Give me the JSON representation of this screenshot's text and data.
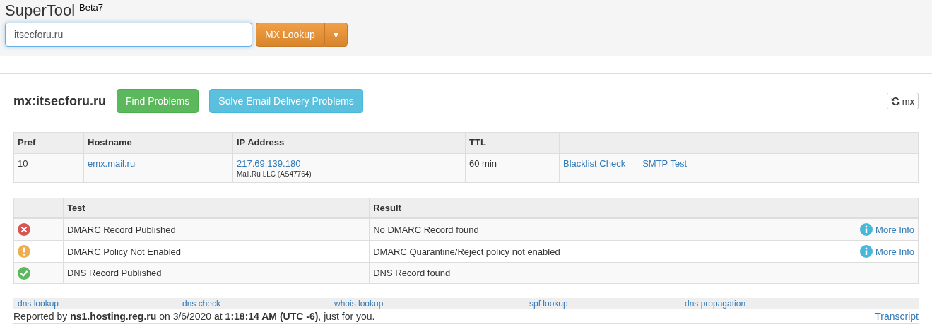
{
  "app": {
    "title": "SuperTool",
    "badge": "Beta7"
  },
  "search": {
    "value": "itsecforu.ru",
    "button": "MX Lookup",
    "caret": "▾"
  },
  "result": {
    "heading": "mx:itsecforu.ru",
    "buttons": [
      {
        "label": "Find Problems",
        "kind": "success"
      },
      {
        "label": "Solve Email Delivery Problems",
        "kind": "info"
      }
    ],
    "refresh": "mx"
  },
  "mx_table": {
    "columns": [
      "Pref",
      "Hostname",
      "IP Address",
      "TTL"
    ],
    "rows": [
      {
        "pref": "10",
        "hostname": "emx.mail.ru",
        "ip": "217.69.139.180",
        "owner": "Mail.Ru LLC (AS47764)",
        "ttl": "60 min",
        "links": [
          "Blacklist Check",
          "SMTP Test"
        ]
      }
    ]
  },
  "tests": {
    "columns": [
      "Test",
      "Result"
    ],
    "rows": [
      {
        "kind": "error",
        "test": "DMARC Record Published",
        "result": "No DMARC Record found",
        "more": "More Info"
      },
      {
        "kind": "warning",
        "test": "DMARC Policy Not Enabled",
        "result": "DMARC Quarantine/Reject policy not enabled",
        "more": "More Info"
      },
      {
        "kind": "pass",
        "test": "DNS Record Published",
        "result": "DNS Record found"
      }
    ]
  },
  "footer_links": [
    "dns lookup",
    "dns check",
    "whois lookup",
    "spf lookup",
    "dns propagation"
  ],
  "report": "Reported by **ns1.hosting.reg.ru** on 3/6/2020 at **1:18:14 AM (UTC -6)**, ",
  "report_link": "just for you",
  "report_end": ".",
  "transcript": "Transcript"
}
